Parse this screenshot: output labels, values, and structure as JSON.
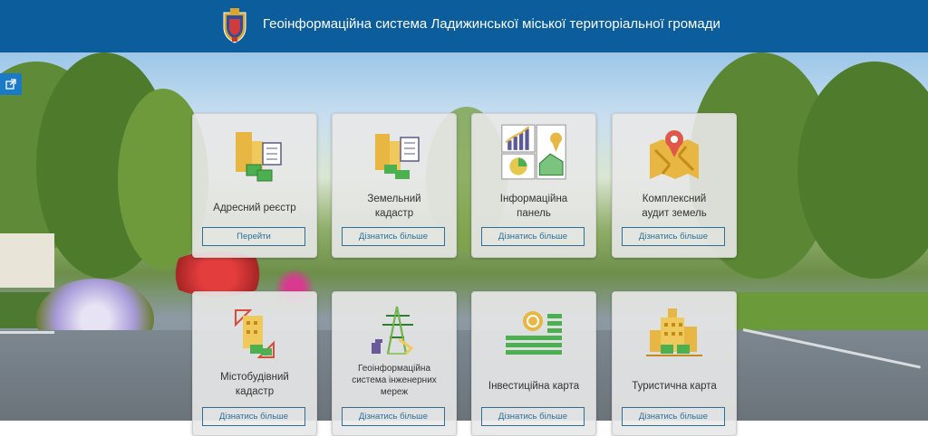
{
  "header": {
    "title": "Геоінформаційна система Ладижинської міської територіальної громади",
    "crest": "city-coat-of-arms"
  },
  "share_icon": "external-link-icon",
  "cards": [
    {
      "label": "Адресний реєстр",
      "button": "Перейти",
      "icon": "buildings-icon"
    },
    {
      "label": "Земельний\nкадастр",
      "button": "Дізнатись більше",
      "icon": "buildings-map-icon"
    },
    {
      "label": "Інформаційна\nпанель",
      "button": "Дізнатись більше",
      "icon": "dashboard-icon"
    },
    {
      "label": "Комплексний\nаудит земель",
      "button": "Дізнатись більше",
      "icon": "map-pin-icon"
    },
    {
      "label": "Містобудівний\nкадастр",
      "button": "Дізнатись більше",
      "icon": "construction-icon"
    },
    {
      "label": "Геоінформаційна\nсистема інженерних\nмереж",
      "button": "Дізнатись більше",
      "icon": "power-tower-icon"
    },
    {
      "label": "Інвестиційна карта",
      "button": "Дізнатись більше",
      "icon": "coin-stack-icon"
    },
    {
      "label": "Туристична карта",
      "button": "Дізнатись більше",
      "icon": "city-tourism-icon"
    }
  ]
}
